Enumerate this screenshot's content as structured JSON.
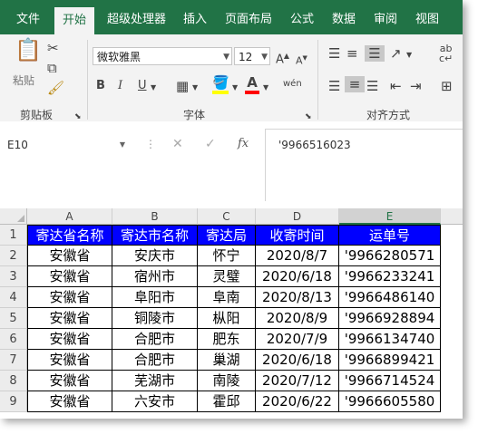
{
  "ribbon_tabs": [
    "文件",
    "开始",
    "超级处理器",
    "插入",
    "页面布局",
    "公式",
    "数据",
    "审阅",
    "视图"
  ],
  "clipboard": {
    "paste_label": "粘贴",
    "group_label": "剪贴板"
  },
  "font": {
    "name": "微软雅黑",
    "size": "12",
    "group_label": "字体",
    "grow": "A",
    "shrink": "A",
    "bold": "B",
    "italic": "I",
    "underline": "U",
    "phonetic": "wén",
    "font_color": "#ff0000",
    "fill_color": "#ffff00"
  },
  "alignment": {
    "group_label": "对齐方式"
  },
  "formula_bar": {
    "name_box": "E10",
    "cancel": "✕",
    "enter": "✓",
    "fx": "fx",
    "content": "'9966516023"
  },
  "columns": [
    "A",
    "B",
    "C",
    "D",
    "E"
  ],
  "selected_column": "E",
  "rows": [
    "1",
    "2",
    "3",
    "4",
    "5",
    "6",
    "7",
    "8",
    "9"
  ],
  "table": {
    "headers": [
      "寄达省名称",
      "寄达市名称",
      "寄达局",
      "收寄时间",
      "运单号"
    ],
    "data": [
      [
        "安徽省",
        "安庆市",
        "怀宁",
        "2020/8/7",
        "'9966280571"
      ],
      [
        "安徽省",
        "宿州市",
        "灵璧",
        "2020/6/18",
        "'9966233241"
      ],
      [
        "安徽省",
        "阜阳市",
        "阜南",
        "2020/8/13",
        "'9966486140"
      ],
      [
        "安徽省",
        "铜陵市",
        "枞阳",
        "2020/8/9",
        "'9966928894"
      ],
      [
        "安徽省",
        "合肥市",
        "肥东",
        "2020/7/9",
        "'9966134740"
      ],
      [
        "安徽省",
        "合肥市",
        "巢湖",
        "2020/6/18",
        "'9966899421"
      ],
      [
        "安徽省",
        "芜湖市",
        "南陵",
        "2020/7/12",
        "'9966714524"
      ],
      [
        "安徽省",
        "六安市",
        "霍邱",
        "2020/6/22",
        "'9966605580"
      ]
    ]
  },
  "colors": {
    "ribbon_green": "#217346",
    "header_fill": "#0000ff",
    "header_text": "#ffffff"
  }
}
